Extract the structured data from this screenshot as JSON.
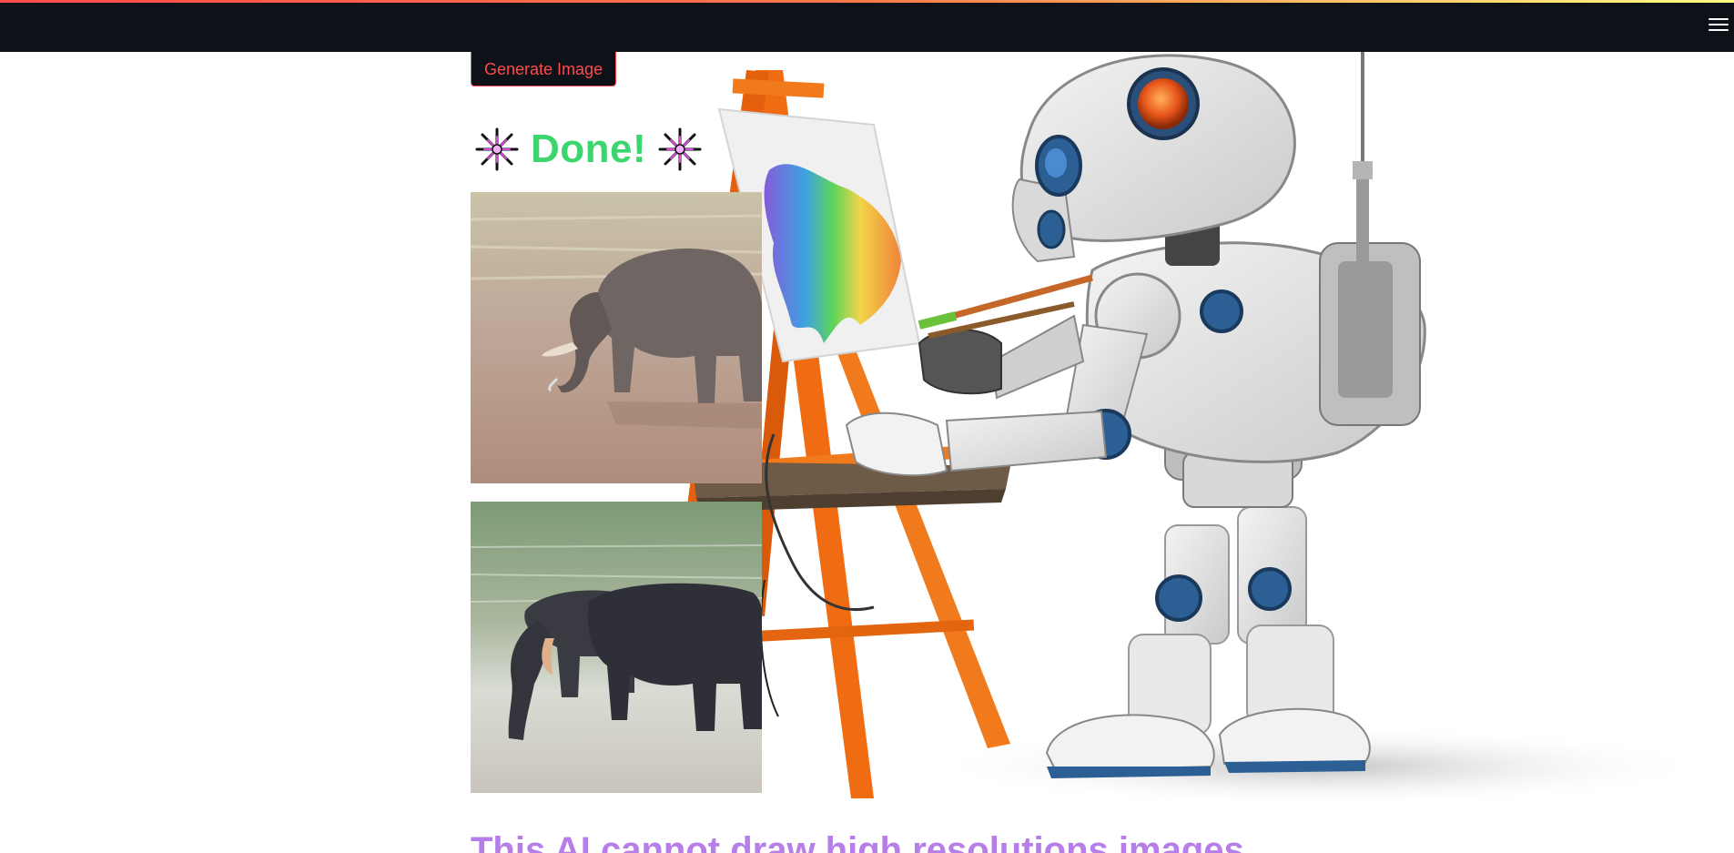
{
  "header": {
    "menu_icon": "hamburger-menu-icon",
    "accent_colors": [
      "#ff4b4b",
      "#fffd80"
    ],
    "background": "#0e1117"
  },
  "main": {
    "generate_button_label": "Generate Image",
    "done_text": "Done!",
    "done_icon": "fireworks-icon",
    "done_color": "#3dd56d",
    "images": [
      {
        "subject": "elephant-in-water-image"
      },
      {
        "subject": "elephants-on-shore-image"
      }
    ],
    "subheading": "This AI cannot draw high resolutions images",
    "subheading_color": "#b57ee8"
  },
  "background": {
    "art": "robot-painting-at-easel-illustration"
  }
}
